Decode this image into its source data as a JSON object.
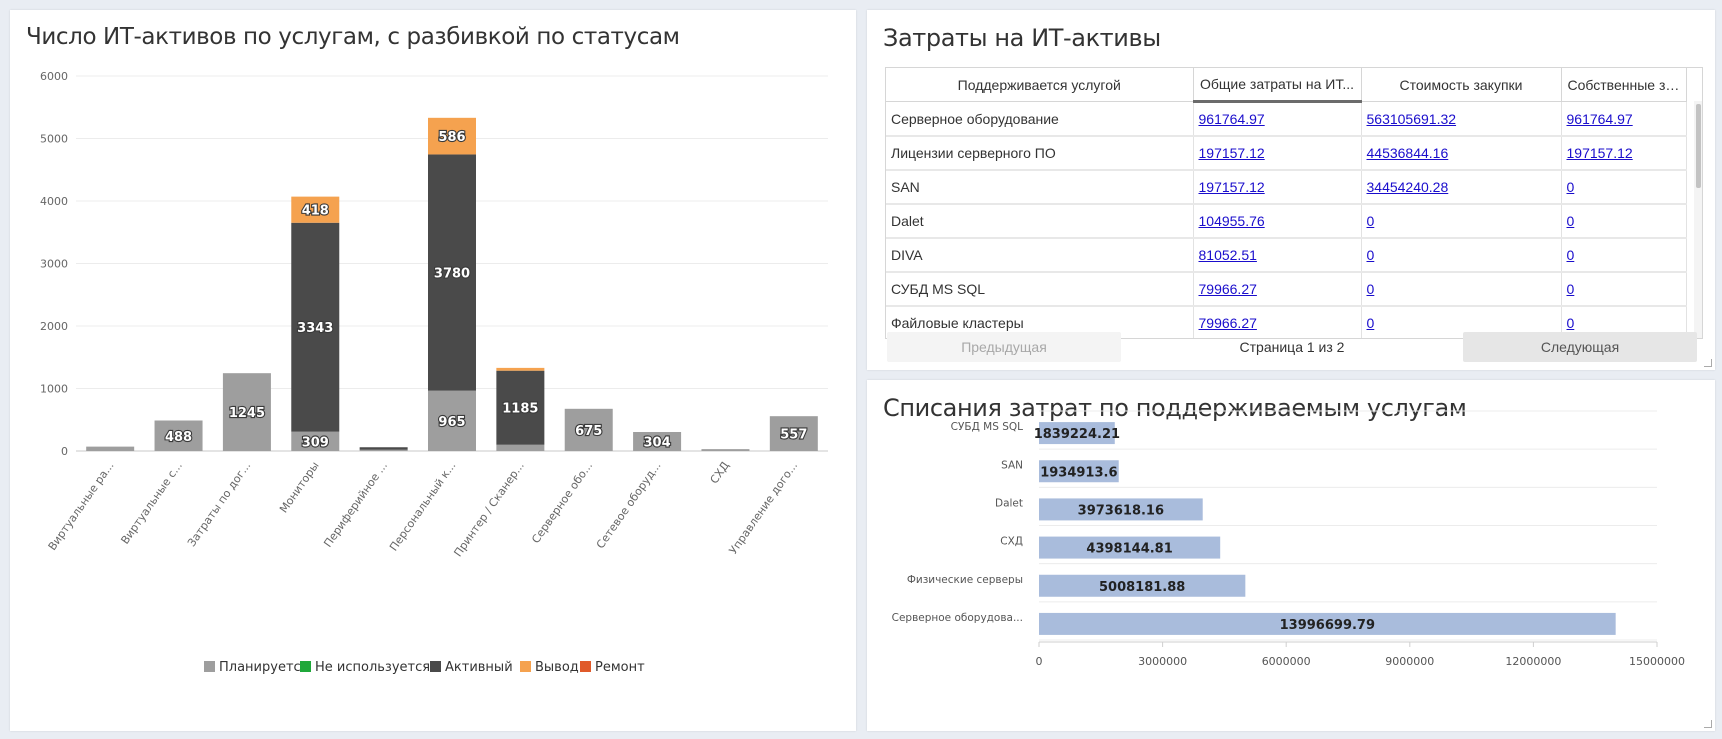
{
  "panels": {
    "left_title": "Число ИТ-активов по услугам, с разбивкой по статусам",
    "table_title": "Затраты на ИТ-активы",
    "bar_title": "Списания затрат по поддерживаемым услугам"
  },
  "chart_data": [
    {
      "type": "bar",
      "stacked": true,
      "title": "Число ИТ-активов по услугам, с разбивкой по статусам",
      "categories": [
        "Виртуальные ра...",
        "Виртуальные с...",
        "Затраты по дог...",
        "Мониторы",
        "Периферийное ...",
        "Персональный к...",
        "Принтер / Сканер...",
        "Серверное обо...",
        "Сетевое оборуд...",
        "СХД",
        "Управление дого..."
      ],
      "series": [
        {
          "name": "Планируется",
          "color": "#9e9e9e",
          "values": [
            70,
            488,
            1245,
            309,
            20,
            965,
            100,
            675,
            304,
            30,
            557
          ]
        },
        {
          "name": "Не используется",
          "color": "#1fa83a",
          "values": [
            0,
            0,
            0,
            0,
            0,
            0,
            0,
            0,
            0,
            0,
            0
          ]
        },
        {
          "name": "Активный",
          "color": "#4a4a4a",
          "values": [
            0,
            0,
            0,
            3343,
            40,
            3780,
            1185,
            0,
            0,
            0,
            0
          ]
        },
        {
          "name": "Вывод",
          "color": "#f5a24f",
          "values": [
            0,
            0,
            0,
            418,
            0,
            586,
            45,
            0,
            0,
            0,
            0
          ]
        },
        {
          "name": "Ремонт",
          "color": "#e05a2a",
          "values": [
            0,
            0,
            0,
            0,
            0,
            0,
            0,
            0,
            0,
            0,
            0
          ]
        }
      ],
      "data_labels": [
        {
          "category": 1,
          "series": 0,
          "text": "488"
        },
        {
          "category": 2,
          "series": 0,
          "text": "1245"
        },
        {
          "category": 3,
          "series": 0,
          "text": "309"
        },
        {
          "category": 3,
          "series": 2,
          "text": "3343"
        },
        {
          "category": 3,
          "series": 3,
          "text": "418"
        },
        {
          "category": 5,
          "series": 0,
          "text": "965"
        },
        {
          "category": 5,
          "series": 2,
          "text": "3780"
        },
        {
          "category": 5,
          "series": 3,
          "text": "586"
        },
        {
          "category": 6,
          "series": 2,
          "text": "1185"
        },
        {
          "category": 7,
          "series": 0,
          "text": "675"
        },
        {
          "category": 8,
          "series": 0,
          "text": "304"
        },
        {
          "category": 10,
          "series": 0,
          "text": "557"
        }
      ],
      "y_ticks": [
        "0",
        "1000",
        "2000",
        "3000",
        "4000",
        "5000",
        "6000"
      ],
      "ylim": [
        0,
        6000
      ],
      "grid": true,
      "legend": "bottom"
    },
    {
      "type": "bar",
      "orientation": "horizontal",
      "title": "Списания затрат по поддерживаемым услугам",
      "color": "#a9bcdc",
      "categories": [
        "СУБД MS SQL",
        "SAN",
        "Dalet",
        "СХД",
        "Физические серверы",
        "Серверное оборудова..."
      ],
      "values": [
        1839224.21,
        1934913.6,
        3973618.16,
        4398144.81,
        5008181.88,
        13996699.79
      ],
      "value_labels": [
        "1839224.21",
        "1934913.6",
        "3973618.16",
        "4398144.81",
        "5008181.88",
        "13996699.79"
      ],
      "x_ticks": [
        "0",
        "3000000",
        "6000000",
        "9000000",
        "12000000",
        "15000000"
      ],
      "xlim": [
        0,
        15000000
      ],
      "grid": true
    }
  ],
  "table": {
    "columns": [
      "Поддерживается услугой",
      "Общие затраты на ИТ...",
      "Стоимость закупки",
      "Собственные за..."
    ],
    "rows": [
      [
        "Серверное оборудование",
        "961764.97",
        "563105691.32",
        "961764.97"
      ],
      [
        "Лицензии серверного ПО",
        "197157.12",
        "44536844.16",
        "197157.12"
      ],
      [
        "SAN",
        "197157.12",
        "34454240.28",
        "0"
      ],
      [
        "Dalet",
        "104955.76",
        "0",
        "0"
      ],
      [
        "DIVA",
        "81052.51",
        "0",
        "0"
      ],
      [
        "СУБД MS SQL",
        "79966.27",
        "0",
        "0"
      ],
      [
        "Файловые кластеры",
        "79966.27",
        "0",
        "0"
      ]
    ],
    "prev_label": "Предыдущая",
    "page_info": "Страница 1 из 2",
    "next_label": "Следующая"
  }
}
